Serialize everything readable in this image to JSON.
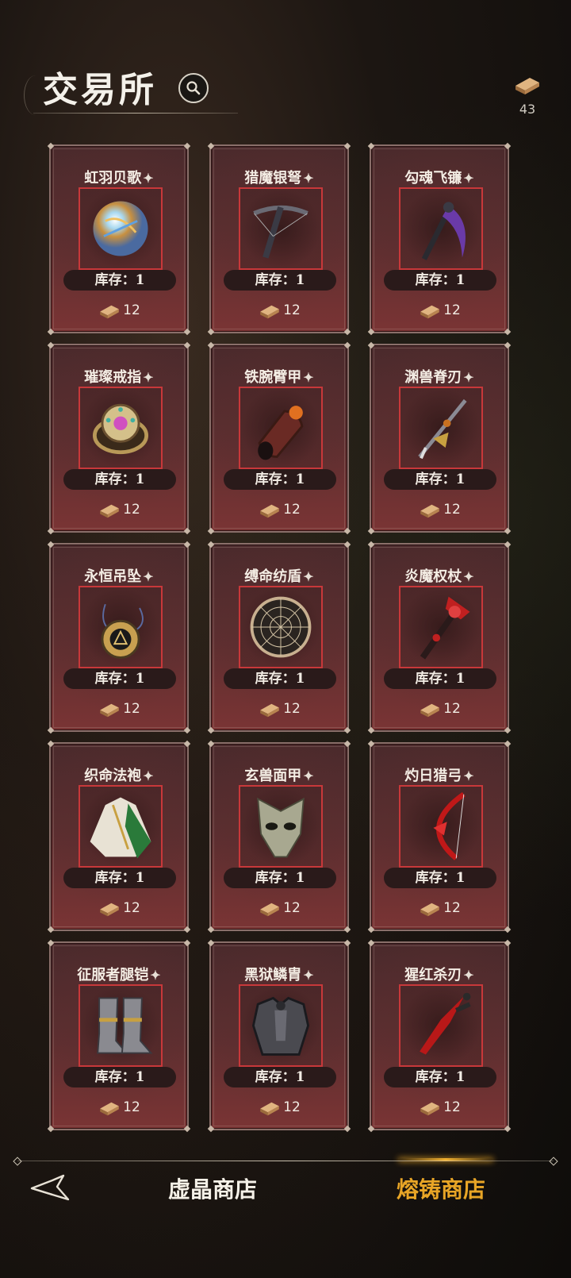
{
  "header": {
    "title": "交易所",
    "currency_value": "43"
  },
  "items": [
    {
      "name": "虹羽贝歌",
      "stock": "库存：1",
      "price": "12",
      "icon": "iridescent-orb-icon"
    },
    {
      "name": "猎魔银弩",
      "stock": "库存：1",
      "price": "12",
      "icon": "crossbow-icon"
    },
    {
      "name": "勾魂飞镰",
      "stock": "库存：1",
      "price": "12",
      "icon": "scythe-icon"
    },
    {
      "name": "璀璨戒指",
      "stock": "库存：1",
      "price": "12",
      "icon": "jeweled-ring-icon"
    },
    {
      "name": "铁腕臂甲",
      "stock": "库存：1",
      "price": "12",
      "icon": "bracer-icon"
    },
    {
      "name": "渊兽脊刃",
      "stock": "库存：1",
      "price": "12",
      "icon": "spine-blade-icon"
    },
    {
      "name": "永恒吊坠",
      "stock": "库存：1",
      "price": "12",
      "icon": "pendant-icon"
    },
    {
      "name": "缚命纺盾",
      "stock": "库存：1",
      "price": "12",
      "icon": "web-shield-icon"
    },
    {
      "name": "炎魔权杖",
      "stock": "库存：1",
      "price": "12",
      "icon": "scepter-icon"
    },
    {
      "name": "织命法袍",
      "stock": "库存：1",
      "price": "12",
      "icon": "robe-icon"
    },
    {
      "name": "玄兽面甲",
      "stock": "库存：1",
      "price": "12",
      "icon": "mask-icon"
    },
    {
      "name": "灼日猎弓",
      "stock": "库存：1",
      "price": "12",
      "icon": "bow-icon"
    },
    {
      "name": "征服者腿铠",
      "stock": "库存：1",
      "price": "12",
      "icon": "greaves-icon"
    },
    {
      "name": "黑狱鳞胄",
      "stock": "库存：1",
      "price": "12",
      "icon": "chest-armor-icon"
    },
    {
      "name": "猩红杀刃",
      "stock": "库存：1",
      "price": "12",
      "icon": "crimson-dagger-icon"
    }
  ],
  "nav": {
    "crystal_shop": "虚晶商店",
    "forge_shop": "熔铸商店"
  },
  "colors": {
    "active_tab": "#e8a526",
    "frame_red": "#c8383a"
  }
}
